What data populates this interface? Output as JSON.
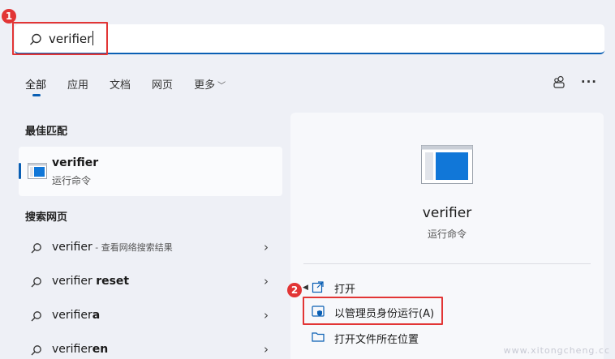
{
  "search": {
    "query": "verifier"
  },
  "annotations": {
    "step1": "1",
    "step2": "2"
  },
  "tabs": [
    {
      "label": "全部"
    },
    {
      "label": "应用"
    },
    {
      "label": "文档"
    },
    {
      "label": "网页"
    },
    {
      "label": "更多"
    }
  ],
  "header_icons": {
    "share": "share-icon",
    "more": "ellipsis-icon",
    "more_glyph": "···"
  },
  "best_match": {
    "title": "最佳匹配",
    "name": "verifier",
    "type": "运行命令"
  },
  "web_search": {
    "title": "搜索网页",
    "items": [
      {
        "prefix": "verifier",
        "bold": "",
        "desc": " - 查看网络搜索结果"
      },
      {
        "prefix": "verifier ",
        "bold": "reset",
        "desc": ""
      },
      {
        "prefix": "verifier",
        "bold": "a",
        "desc": ""
      },
      {
        "prefix": "verifier",
        "bold": "en",
        "desc": ""
      }
    ]
  },
  "detail": {
    "name": "verifier",
    "type": "运行命令",
    "actions": [
      {
        "label": "打开",
        "icon": "open-icon"
      },
      {
        "label": "以管理员身份运行(A)",
        "icon": "shield-icon"
      },
      {
        "label": "打开文件所在位置",
        "icon": "folder-icon"
      }
    ]
  },
  "colors": {
    "accent": "#0a5fb4",
    "annotation": "#e23535",
    "background": "#eef0f6"
  },
  "watermark": "www.xitongcheng.cc"
}
